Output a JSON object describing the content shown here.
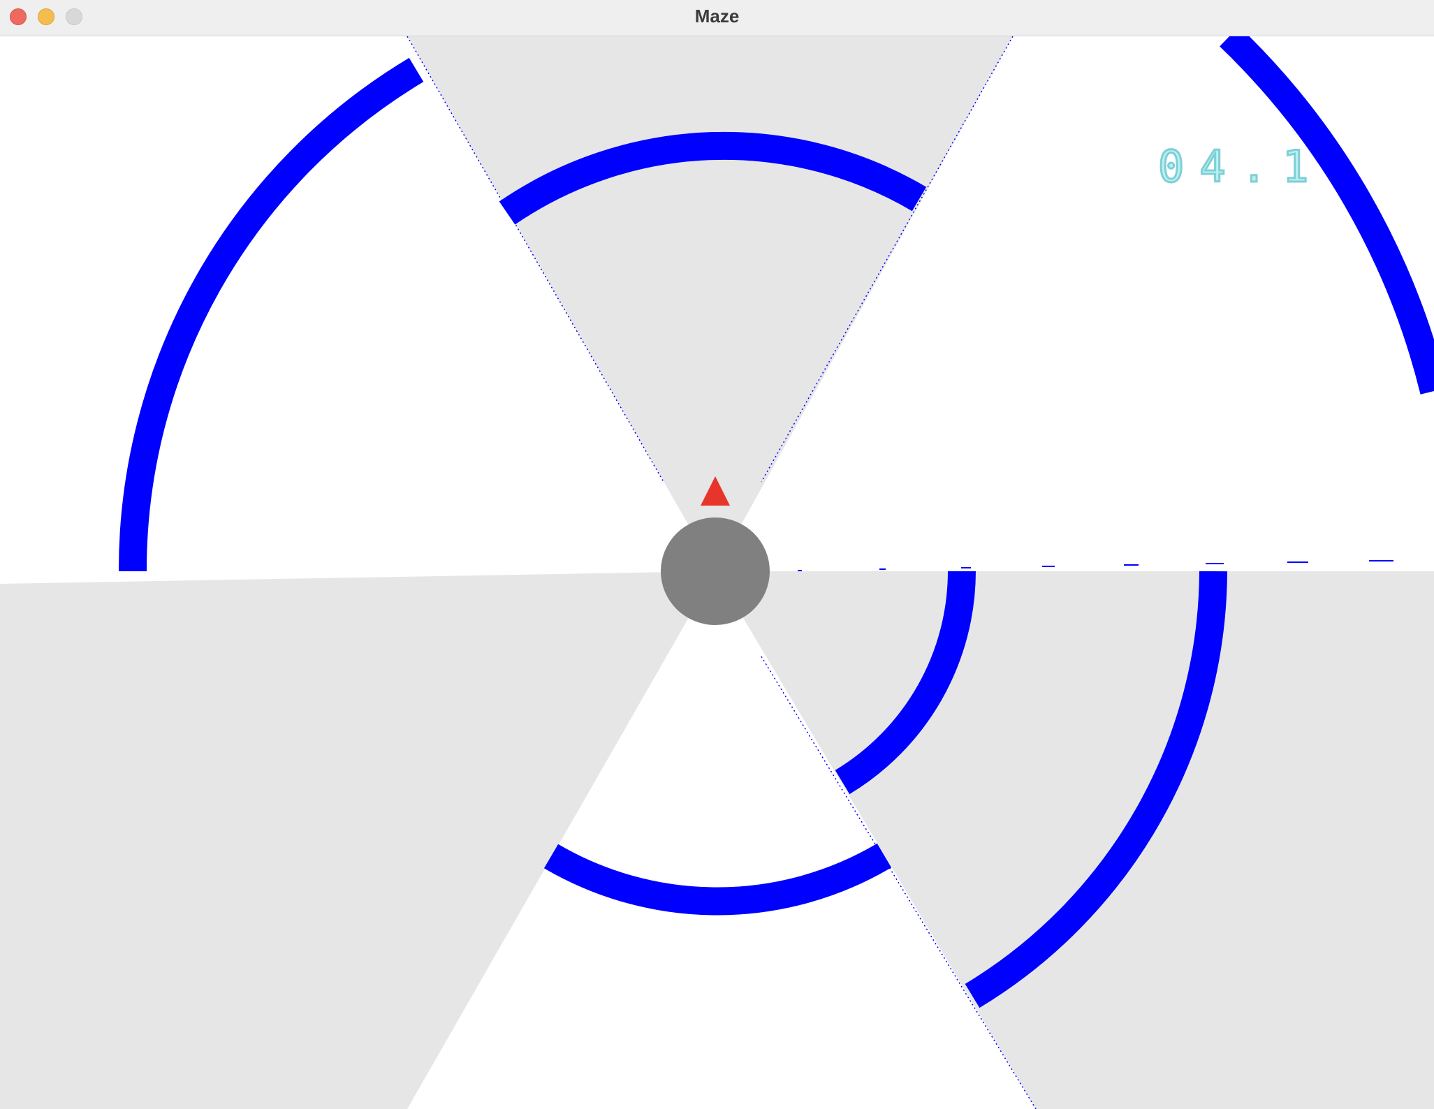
{
  "window": {
    "title": "Maze",
    "controls": {
      "close_color": "#ee6a5f",
      "minimize_color": "#f5bd4f",
      "maximize_color": "#d8d8d8"
    }
  },
  "game": {
    "timer_text": "04.1",
    "colors": {
      "background": "#ffffff",
      "sector_shade": "#e6e6e6",
      "wall": "#0000ff",
      "player": "#e8352b",
      "hub": "#808080",
      "timer": "#b8f1f4"
    },
    "player_icon": "triangle-up",
    "hub_icon": "circle"
  }
}
